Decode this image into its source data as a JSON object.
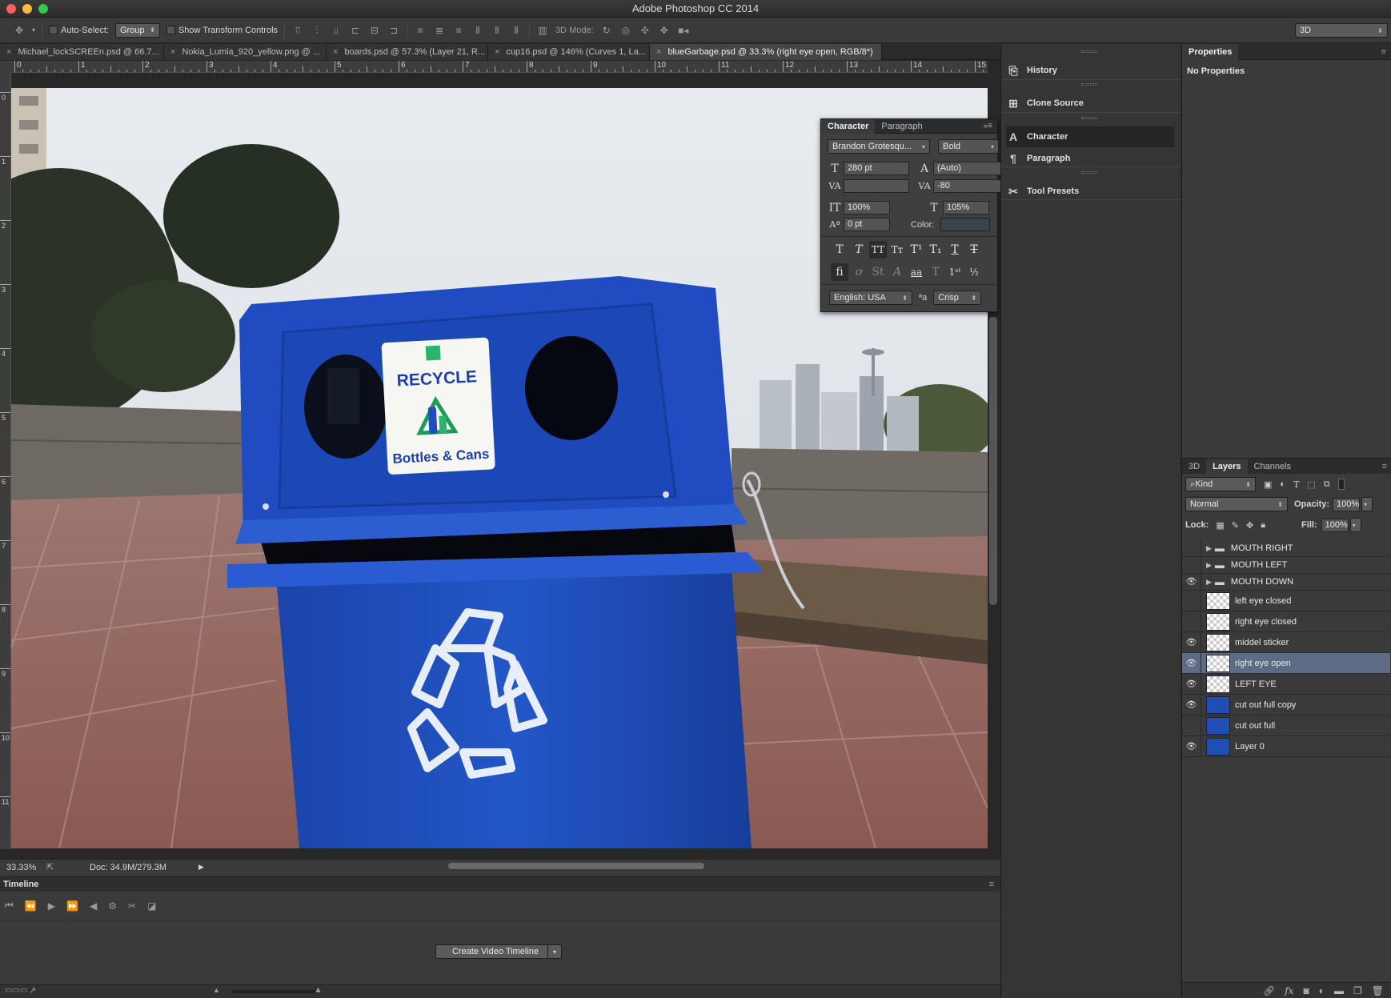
{
  "window": {
    "title": "Adobe Photoshop CC 2014"
  },
  "options_bar": {
    "auto_select_label": "Auto-Select:",
    "auto_select_value": "Group",
    "show_transform_label": "Show Transform Controls",
    "mode_3d_label": "3D Mode:",
    "workspace_value": "3D"
  },
  "tabs": [
    {
      "label": "Michael_lockSCREEn.psd @ 66.7...",
      "active": false
    },
    {
      "label": "Nokia_Lumia_920_yellow.png @ ...",
      "active": false
    },
    {
      "label": "boards.psd @ 57.3% (Layer 21, R...",
      "active": false
    },
    {
      "label": "cup16.psd @ 146% (Curves 1, La...",
      "active": false
    },
    {
      "label": "blueGarbage.psd @ 33.3% (right eye open, RGB/8*)",
      "active": true
    }
  ],
  "ruler": {
    "h_numbers": [
      "0",
      "1",
      "2",
      "3",
      "4",
      "5",
      "6",
      "7",
      "8",
      "9",
      "10",
      "11",
      "12",
      "13",
      "14",
      "15"
    ],
    "v_numbers": [
      "0",
      "1",
      "2",
      "3",
      "4",
      "5",
      "6",
      "7",
      "8",
      "9",
      "10",
      "11"
    ]
  },
  "sticker": {
    "top": "RECYCLE",
    "bottom": "Bottles & Cans"
  },
  "status": {
    "zoom": "33.33%",
    "doc": "Doc: 34.9M/279.3M"
  },
  "timeline": {
    "title": "Timeline",
    "create_button": "Create Video Timeline"
  },
  "collapsed_panels": [
    {
      "label": "History",
      "icon": "history-icon"
    },
    {
      "label": "Clone Source",
      "icon": "clone-source-icon"
    },
    {
      "label": "Character",
      "icon": "character-icon",
      "active": true
    },
    {
      "label": "Paragraph",
      "icon": "paragraph-icon"
    },
    {
      "label": "Tool Presets",
      "icon": "tool-presets-icon"
    }
  ],
  "properties": {
    "tab": "Properties",
    "body": "No Properties"
  },
  "character": {
    "tab_character": "Character",
    "tab_paragraph": "Paragraph",
    "font_family": "Brandon Grotesqu...",
    "font_style": "Bold",
    "font_size": "280 pt",
    "leading": "(Auto)",
    "kerning": "",
    "tracking": "-80",
    "vertical_scale": "100%",
    "horizontal_scale": "105%",
    "baseline_shift": "0 pt",
    "color_label": "Color:",
    "language": "English: USA",
    "aa_label": "a",
    "antialias": "Crisp"
  },
  "layers_panel": {
    "tab_3d": "3D",
    "tab_layers": "Layers",
    "tab_channels": "Channels",
    "filter_kind": "Kind",
    "blend_mode": "Normal",
    "opacity_label": "Opacity:",
    "opacity": "100%",
    "lock_label": "Lock:",
    "fill_label": "Fill:",
    "fill": "100%",
    "layers": [
      {
        "name": "MOUTH RIGHT",
        "type": "group",
        "visible": false,
        "selected": false
      },
      {
        "name": "MOUTH LEFT",
        "type": "group",
        "visible": false,
        "selected": false
      },
      {
        "name": "MOUTH DOWN",
        "type": "group",
        "visible": true,
        "selected": false
      },
      {
        "name": "left eye closed",
        "type": "pixel",
        "visible": false,
        "selected": false
      },
      {
        "name": "right eye closed",
        "type": "pixel",
        "visible": false,
        "selected": false
      },
      {
        "name": "middel sticker",
        "type": "pixel",
        "visible": true,
        "selected": false
      },
      {
        "name": "right eye open",
        "type": "pixel",
        "visible": true,
        "selected": true
      },
      {
        "name": "LEFT EYE",
        "type": "pixel",
        "visible": true,
        "selected": false
      },
      {
        "name": "cut out full copy",
        "type": "image",
        "visible": true,
        "selected": false
      },
      {
        "name": "cut out full",
        "type": "image",
        "visible": false,
        "selected": false
      },
      {
        "name": "Layer 0",
        "type": "image",
        "visible": true,
        "selected": false
      }
    ]
  },
  "colors": {
    "selected_layer": "#5d6b85",
    "bin_blue": "#1f4fb4"
  }
}
